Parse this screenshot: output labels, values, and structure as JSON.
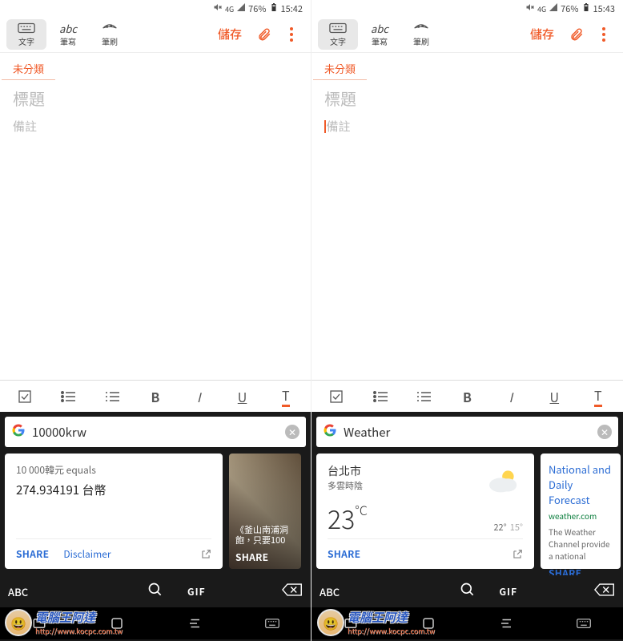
{
  "screens": [
    {
      "status": {
        "network": "4G",
        "battery": "76%",
        "time": "15:42"
      },
      "toolbar": {
        "text": "文字",
        "write": "筆寫",
        "brush": "筆刷",
        "save": "儲存"
      },
      "category": "未分類",
      "title_placeholder": "標題",
      "note_placeholder": "備註",
      "search_query": "10000krw",
      "card_currency": {
        "equals_line": "10 000韓元 equals",
        "value": "274.934191 台幣",
        "share": "SHARE",
        "disclaimer": "Disclaimer"
      },
      "card_image": {
        "title": "《釜山南浦洞飽，只要100",
        "share": "SHARE"
      },
      "kb": {
        "abc": "ABC",
        "gif": "GIF"
      }
    },
    {
      "status": {
        "network": "4G",
        "battery": "76%",
        "time": "15:43"
      },
      "toolbar": {
        "text": "文字",
        "write": "筆寫",
        "brush": "筆刷",
        "save": "儲存"
      },
      "category": "未分類",
      "title_placeholder": "標題",
      "note_placeholder": "備註",
      "search_query": "Weather",
      "card_weather": {
        "city": "台北市",
        "cond": "多雲時陰",
        "temp": "23",
        "unit": "°C",
        "hi": "22°",
        "lo": "15°",
        "share": "SHARE"
      },
      "card_wc": {
        "title": "National and Daily Forecast",
        "src": "weather.com",
        "desc": "The Weather Channel provide a national",
        "share": "SHARE"
      },
      "kb": {
        "abc": "ABC",
        "gif": "GIF"
      }
    }
  ],
  "watermark": {
    "title": "電腦王阿達",
    "url": "http://www.kocpc.com.tw"
  }
}
